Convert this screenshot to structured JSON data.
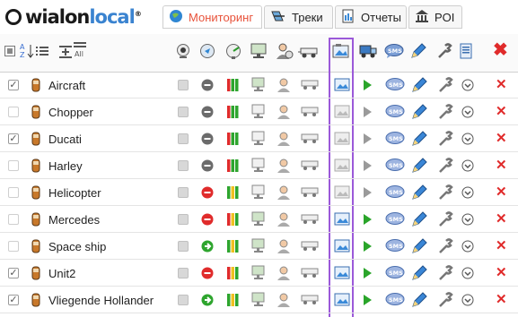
{
  "logo": {
    "part1": "wialon",
    "part2": "local",
    "reg": "®"
  },
  "tabs": [
    {
      "label": "Мониторинг",
      "icon": "globe-icon",
      "active": true
    },
    {
      "label": "Треки",
      "icon": "track-icon",
      "active": false
    },
    {
      "label": "Отчеты",
      "icon": "report-icon",
      "active": false
    },
    {
      "label": "POI",
      "icon": "poi-icon",
      "active": false
    }
  ],
  "header_icons": [
    "list-view-icon",
    "sort-icon",
    "list-icon",
    "expand-icon",
    "all-icon",
    "webcam-icon",
    "locate-icon",
    "radar-icon",
    "monitor-icon",
    "driver-icon",
    "trailer-icon",
    "photo-icon",
    "truck-icon",
    "sms-icon",
    "edit-icon",
    "wrench-icon",
    "properties-icon",
    "delete-icon"
  ],
  "header_text": {
    "sort": "A Z",
    "all": "All"
  },
  "units": [
    {
      "name": "Aircraft",
      "checked": true,
      "active": true,
      "state": "gray"
    },
    {
      "name": "Chopper",
      "checked": false,
      "active": false,
      "state": "gray"
    },
    {
      "name": "Ducati",
      "checked": true,
      "active": false,
      "state": "gray"
    },
    {
      "name": "Harley",
      "checked": false,
      "active": false,
      "state": "gray"
    },
    {
      "name": "Helicopter",
      "checked": false,
      "active": false,
      "state": "red"
    },
    {
      "name": "Mercedes",
      "checked": false,
      "active": true,
      "state": "red"
    },
    {
      "name": "Space ship",
      "checked": false,
      "active": true,
      "state": "green"
    },
    {
      "name": "Unit2",
      "checked": true,
      "active": true,
      "state": "red"
    },
    {
      "name": "Vliegende Hollander",
      "checked": true,
      "active": true,
      "state": "green"
    }
  ],
  "colors": {
    "accent": "#e8523a",
    "highlight": "#9b59d9",
    "red": "#e02b2b",
    "green": "#2aa52a"
  }
}
